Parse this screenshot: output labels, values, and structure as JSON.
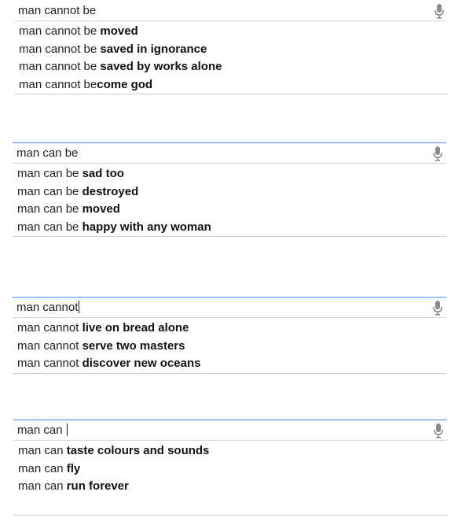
{
  "blocks": [
    {
      "query": "man cannot be",
      "show_caret": false,
      "suggestions": [
        {
          "prefix": "man cannot be ",
          "rest": "moved"
        },
        {
          "prefix": "man cannot be ",
          "rest": "saved in ignorance"
        },
        {
          "prefix": "man cannot be ",
          "rest": "saved by works alone"
        },
        {
          "prefix": "man cannot be",
          "rest": "come god"
        }
      ]
    },
    {
      "query": "man can be",
      "show_caret": false,
      "suggestions": [
        {
          "prefix": "man can be ",
          "rest": "sad too"
        },
        {
          "prefix": "man can be ",
          "rest": "destroyed"
        },
        {
          "prefix": "man can be ",
          "rest": "moved"
        },
        {
          "prefix": "man can be ",
          "rest": "happy with any woman"
        }
      ]
    },
    {
      "query": "man cannot",
      "show_caret": true,
      "suggestions": [
        {
          "prefix": "man cannot ",
          "rest": "live on bread alone"
        },
        {
          "prefix": "man cannot ",
          "rest": "serve two masters"
        },
        {
          "prefix": "man cannot ",
          "rest": "discover new oceans"
        }
      ]
    },
    {
      "query": "man can ",
      "show_caret": true,
      "suggestions": [
        {
          "prefix": "man can ",
          "rest": "taste colours and sounds"
        },
        {
          "prefix": "man can ",
          "rest": "fly"
        },
        {
          "prefix": "man can ",
          "rest": "run forever"
        }
      ]
    }
  ],
  "icons": {
    "mic": "microphone-icon"
  },
  "colors": {
    "focus_border": "#4d90fe",
    "divider": "#d9d9d9",
    "mic": "#8a8a8a"
  }
}
